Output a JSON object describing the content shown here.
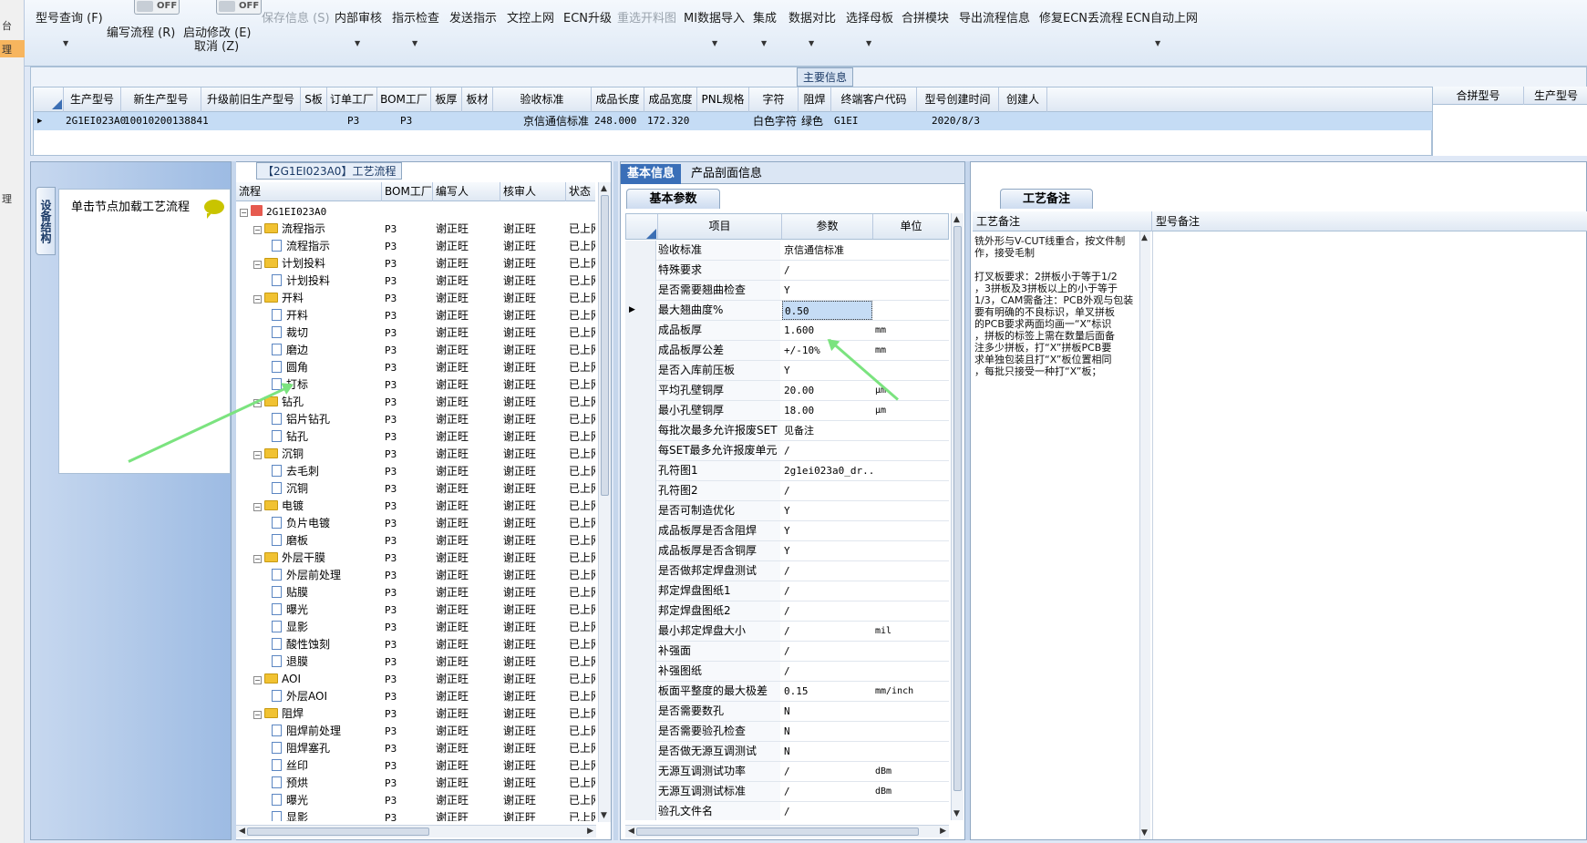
{
  "left_strip": {
    "items": [
      "台",
      "理",
      "理"
    ]
  },
  "ribbon": {
    "buttons": [
      {
        "label": "型号查询 (F)",
        "key": "model-query"
      },
      {
        "label": "编写流程 (R)",
        "key": "write-flow"
      },
      {
        "label": "启动修改 (E)",
        "key": "start-edit"
      },
      {
        "label": "取消 (Z)",
        "key": "cancel"
      },
      {
        "label": "保存信息 (S)",
        "key": "save-info"
      },
      {
        "label": "内部审核",
        "key": "internal-review"
      },
      {
        "label": "指示检查",
        "key": "instruction-check"
      },
      {
        "label": "发送指示",
        "key": "send-instruction"
      },
      {
        "label": "文控上网",
        "key": "doc-control-online"
      },
      {
        "label": "ECN升级",
        "key": "ecn-upgrade"
      },
      {
        "label": "重选开料图",
        "key": "reselect-cutting"
      },
      {
        "label": "MI数据导入",
        "key": "mi-import"
      },
      {
        "label": "集成",
        "key": "integrate"
      },
      {
        "label": "数据对比",
        "key": "data-compare"
      },
      {
        "label": "选择母板",
        "key": "select-master"
      },
      {
        "label": "合拼模块",
        "key": "merge-module"
      },
      {
        "label": "导出流程信息",
        "key": "export-flow"
      },
      {
        "label": "修复ECN丢流程",
        "key": "fix-ecn"
      },
      {
        "label": "ECN自动上网",
        "key": "ecn-auto"
      }
    ],
    "toggle_label": "OFF"
  },
  "main_info": {
    "caption": "主要信息",
    "columns": [
      "生产型号",
      "新生产型号",
      "升级前旧生产型号",
      "S板",
      "订单工厂",
      "BOM工厂",
      "板厚",
      "板材",
      "验收标准",
      "成品长度",
      "成品宽度",
      "PNL规格",
      "字符",
      "阻焊",
      "终端客户代码",
      "型号创建时间",
      "创建人"
    ],
    "row": [
      "2G1EI023A0",
      "10010200138841",
      "",
      "",
      "P3",
      "P3",
      "",
      "",
      "京信通信标准",
      "248.000",
      "172.320",
      "",
      "白色字符",
      "绿色",
      "G1EI",
      "2020/8/3",
      ""
    ],
    "right_columns": [
      "合拼型号",
      "生产型号"
    ]
  },
  "left_panel": {
    "vtab": "设备结构",
    "hint": "单击节点加载工艺流程"
  },
  "flow": {
    "caption": "【2G1EI023A0】工艺流程",
    "columns": [
      "流程",
      "BOM工厂",
      "编写人",
      "核审人",
      "状态"
    ],
    "root": "2G1EI023A0",
    "rows": [
      {
        "name": "流程指示",
        "level": 1,
        "bom": "P3",
        "writer": "谢正旺",
        "reviewer": "谢正旺",
        "status": "已上网"
      },
      {
        "name": "流程指示",
        "level": 2,
        "bom": "P3",
        "writer": "谢正旺",
        "reviewer": "谢正旺",
        "status": "已上网"
      },
      {
        "name": "计划投料",
        "level": 1,
        "bom": "P3",
        "writer": "谢正旺",
        "reviewer": "谢正旺",
        "status": "已上网"
      },
      {
        "name": "计划投料",
        "level": 2,
        "bom": "P3",
        "writer": "谢正旺",
        "reviewer": "谢正旺",
        "status": "已上网"
      },
      {
        "name": "开料",
        "level": 1,
        "bom": "P3",
        "writer": "谢正旺",
        "reviewer": "谢正旺",
        "status": "已上网"
      },
      {
        "name": "开料",
        "level": 2,
        "bom": "P3",
        "writer": "谢正旺",
        "reviewer": "谢正旺",
        "status": "已上网"
      },
      {
        "name": "裁切",
        "level": 2,
        "bom": "P3",
        "writer": "谢正旺",
        "reviewer": "谢正旺",
        "status": "已上网"
      },
      {
        "name": "磨边",
        "level": 2,
        "bom": "P3",
        "writer": "谢正旺",
        "reviewer": "谢正旺",
        "status": "已上网"
      },
      {
        "name": "圆角",
        "level": 2,
        "bom": "P3",
        "writer": "谢正旺",
        "reviewer": "谢正旺",
        "status": "已上网"
      },
      {
        "name": "打标",
        "level": 2,
        "bom": "P3",
        "writer": "谢正旺",
        "reviewer": "谢正旺",
        "status": "已上网"
      },
      {
        "name": "钻孔",
        "level": 1,
        "bom": "P3",
        "writer": "谢正旺",
        "reviewer": "谢正旺",
        "status": "已上网"
      },
      {
        "name": "铝片钻孔",
        "level": 2,
        "bom": "P3",
        "writer": "谢正旺",
        "reviewer": "谢正旺",
        "status": "已上网"
      },
      {
        "name": "钻孔",
        "level": 2,
        "bom": "P3",
        "writer": "谢正旺",
        "reviewer": "谢正旺",
        "status": "已上网"
      },
      {
        "name": "沉铜",
        "level": 1,
        "bom": "P3",
        "writer": "谢正旺",
        "reviewer": "谢正旺",
        "status": "已上网"
      },
      {
        "name": "去毛刺",
        "level": 2,
        "bom": "P3",
        "writer": "谢正旺",
        "reviewer": "谢正旺",
        "status": "已上网"
      },
      {
        "name": "沉铜",
        "level": 2,
        "bom": "P3",
        "writer": "谢正旺",
        "reviewer": "谢正旺",
        "status": "已上网"
      },
      {
        "name": "电镀",
        "level": 1,
        "bom": "P3",
        "writer": "谢正旺",
        "reviewer": "谢正旺",
        "status": "已上网"
      },
      {
        "name": "负片电镀",
        "level": 2,
        "bom": "P3",
        "writer": "谢正旺",
        "reviewer": "谢正旺",
        "status": "已上网"
      },
      {
        "name": "磨板",
        "level": 2,
        "bom": "P3",
        "writer": "谢正旺",
        "reviewer": "谢正旺",
        "status": "已上网"
      },
      {
        "name": "外层干膜",
        "level": 1,
        "bom": "P3",
        "writer": "谢正旺",
        "reviewer": "谢正旺",
        "status": "已上网"
      },
      {
        "name": "外层前处理",
        "level": 2,
        "bom": "P3",
        "writer": "谢正旺",
        "reviewer": "谢正旺",
        "status": "已上网"
      },
      {
        "name": "贴膜",
        "level": 2,
        "bom": "P3",
        "writer": "谢正旺",
        "reviewer": "谢正旺",
        "status": "已上网"
      },
      {
        "name": "曝光",
        "level": 2,
        "bom": "P3",
        "writer": "谢正旺",
        "reviewer": "谢正旺",
        "status": "已上网"
      },
      {
        "name": "显影",
        "level": 2,
        "bom": "P3",
        "writer": "谢正旺",
        "reviewer": "谢正旺",
        "status": "已上网"
      },
      {
        "name": "酸性蚀刻",
        "level": 2,
        "bom": "P3",
        "writer": "谢正旺",
        "reviewer": "谢正旺",
        "status": "已上网"
      },
      {
        "name": "退膜",
        "level": 2,
        "bom": "P3",
        "writer": "谢正旺",
        "reviewer": "谢正旺",
        "status": "已上网"
      },
      {
        "name": "AOI",
        "level": 1,
        "bom": "P3",
        "writer": "谢正旺",
        "reviewer": "谢正旺",
        "status": "已上网"
      },
      {
        "name": "外层AOI",
        "level": 2,
        "bom": "P3",
        "writer": "谢正旺",
        "reviewer": "谢正旺",
        "status": "已上网"
      },
      {
        "name": "阻焊",
        "level": 1,
        "bom": "P3",
        "writer": "谢正旺",
        "reviewer": "谢正旺",
        "status": "已上网"
      },
      {
        "name": "阻焊前处理",
        "level": 2,
        "bom": "P3",
        "writer": "谢正旺",
        "reviewer": "谢正旺",
        "status": "已上网"
      },
      {
        "name": "阻焊塞孔",
        "level": 2,
        "bom": "P3",
        "writer": "谢正旺",
        "reviewer": "谢正旺",
        "status": "已上网"
      },
      {
        "name": "丝印",
        "level": 2,
        "bom": "P3",
        "writer": "谢正旺",
        "reviewer": "谢正旺",
        "status": "已上网"
      },
      {
        "name": "预烘",
        "level": 2,
        "bom": "P3",
        "writer": "谢正旺",
        "reviewer": "谢正旺",
        "status": "已上网"
      },
      {
        "name": "曝光",
        "level": 2,
        "bom": "P3",
        "writer": "谢正旺",
        "reviewer": "谢正旺",
        "status": "已上网"
      },
      {
        "name": "显影",
        "level": 2,
        "bom": "P3",
        "writer": "谢正旺",
        "reviewer": "谢正旺",
        "status": "已上网"
      }
    ]
  },
  "basic": {
    "tabs": [
      "基本信息",
      "产品剖面信息"
    ],
    "subtab": "基本参数",
    "columns": [
      "项目",
      "参数",
      "单位"
    ],
    "rows": [
      {
        "k": "验收标准",
        "v": "京信通信标准",
        "u": ""
      },
      {
        "k": "特殊要求",
        "v": "/",
        "u": ""
      },
      {
        "k": "是否需要翘曲检查",
        "v": "Y",
        "u": ""
      },
      {
        "k": "最大翘曲度%",
        "v": "0.50",
        "u": "",
        "selected": true
      },
      {
        "k": "成品板厚",
        "v": "1.600",
        "u": "mm"
      },
      {
        "k": "成品板厚公差",
        "v": "+/-10%",
        "u": "mm"
      },
      {
        "k": "是否入库前压板",
        "v": "Y",
        "u": ""
      },
      {
        "k": "平均孔壁铜厚",
        "v": "20.00",
        "u": "µm"
      },
      {
        "k": "最小孔壁铜厚",
        "v": "18.00",
        "u": "µm"
      },
      {
        "k": "每批次最多允许报废SET",
        "v": "见备注",
        "u": ""
      },
      {
        "k": "每SET最多允许报废单元",
        "v": "/",
        "u": ""
      },
      {
        "k": "孔符图1",
        "v": "2g1ei023a0_dr...",
        "u": ""
      },
      {
        "k": "孔符图2",
        "v": "/",
        "u": ""
      },
      {
        "k": "是否可制造优化",
        "v": "Y",
        "u": ""
      },
      {
        "k": "成品板厚是否含阻焊",
        "v": "Y",
        "u": ""
      },
      {
        "k": "成品板厚是否含铜厚",
        "v": "Y",
        "u": ""
      },
      {
        "k": "是否做邦定焊盘测试",
        "v": "/",
        "u": ""
      },
      {
        "k": "邦定焊盘图纸1",
        "v": "/",
        "u": ""
      },
      {
        "k": "邦定焊盘图纸2",
        "v": "/",
        "u": ""
      },
      {
        "k": "最小邦定焊盘大小",
        "v": "/",
        "u": "mil"
      },
      {
        "k": "补强面",
        "v": "/",
        "u": ""
      },
      {
        "k": "补强图纸",
        "v": "/",
        "u": ""
      },
      {
        "k": "板面平整度的最大极差",
        "v": "0.15",
        "u": "mm/inch"
      },
      {
        "k": "是否需要数孔",
        "v": "N",
        "u": ""
      },
      {
        "k": "是否需要验孔检查",
        "v": "N",
        "u": ""
      },
      {
        "k": "是否做无源互调测试",
        "v": "N",
        "u": ""
      },
      {
        "k": "无源互调测试功率",
        "v": "/",
        "u": "dBm"
      },
      {
        "k": "无源互调测试标准",
        "v": "/",
        "u": "dBm"
      },
      {
        "k": "验孔文件名",
        "v": "/",
        "u": ""
      }
    ]
  },
  "remarks": {
    "tab": "工艺备注",
    "columns": [
      "工艺备注",
      "型号备注"
    ],
    "text": "铣外形与V-CUT线重合，按文件制\n作，接受毛制\n\n打叉板要求：2拼板小于等于1/2\n，3拼板及3拼板以上的小于等于\n1/3，CAM需备注：PCB外观与包装\n要有明确的不良标识，单叉拼板\n的PCB要求两面均画一“X”标识\n，拼板的标签上需在数量后面备\n注多少拼板，打“X”拼板PCB要\n求单独包装且打“X”板位置相同\n，每批只接受一种打“X”板；"
  },
  "accent": {
    "selection": "#c5dcf5",
    "active_tab": "#3a6fb8",
    "arrow": "#7be37f",
    "folder": "#f1c232"
  }
}
